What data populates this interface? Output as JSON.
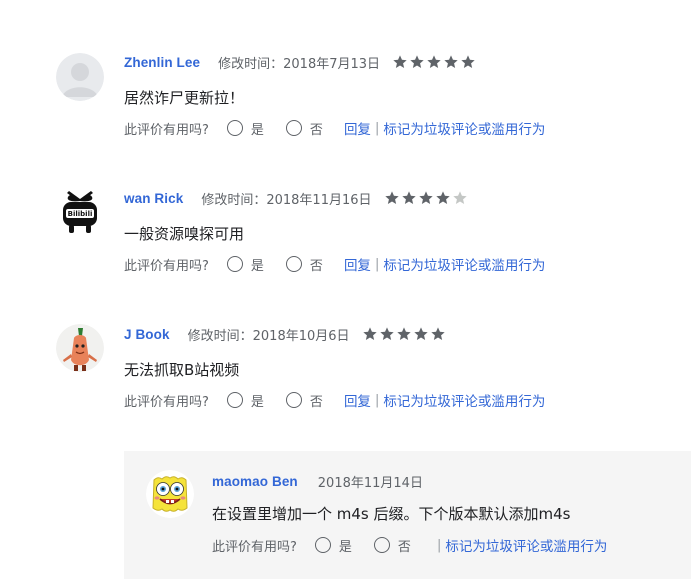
{
  "reviews": [
    {
      "author": "Zhenlin Lee",
      "date_label": "修改时间：",
      "date": "2018年7月13日",
      "rating": 5,
      "text": "居然诈尸更新拉！",
      "helpful_label": "此评价有用吗?",
      "yes": "是",
      "no": "否",
      "reply": "回复",
      "sep": "|",
      "report": "标记为垃圾评论或滥用行为"
    },
    {
      "author": "wan Rick",
      "date_label": "修改时间：",
      "date": "2018年11月16日",
      "rating": 4,
      "text": "一般资源嗅探可用",
      "helpful_label": "此评价有用吗?",
      "yes": "是",
      "no": "否",
      "reply": "回复",
      "sep": "|",
      "report": "标记为垃圾评论或滥用行为"
    },
    {
      "author": "J Book",
      "date_label": "修改时间：",
      "date": "2018年10月6日",
      "rating": 5,
      "text": "无法抓取B站视频",
      "helpful_label": "此评价有用吗?",
      "yes": "是",
      "no": "否",
      "reply": "回复",
      "sep": "|",
      "report": "标记为垃圾评论或滥用行为"
    }
  ],
  "developer_reply": {
    "author": "maomao Ben",
    "date": "2018年11月14日",
    "text": "在设置里增加一个 m4s 后缀。下个版本默认添加m4s",
    "helpful_label": "此评价有用吗?",
    "yes": "是",
    "no": "否",
    "sep": "|",
    "report": "标记为垃圾评论或滥用行为"
  },
  "avatar_icons": [
    "default-user-avatar",
    "bilibili-tv-avatar",
    "cartoon-figure-avatar",
    "spongebob-avatar"
  ],
  "colors": {
    "link": "#3367d6",
    "star_filled": "#5f6368",
    "star_empty": "#c4c7c5",
    "reply_bg": "#f5f5f5"
  }
}
